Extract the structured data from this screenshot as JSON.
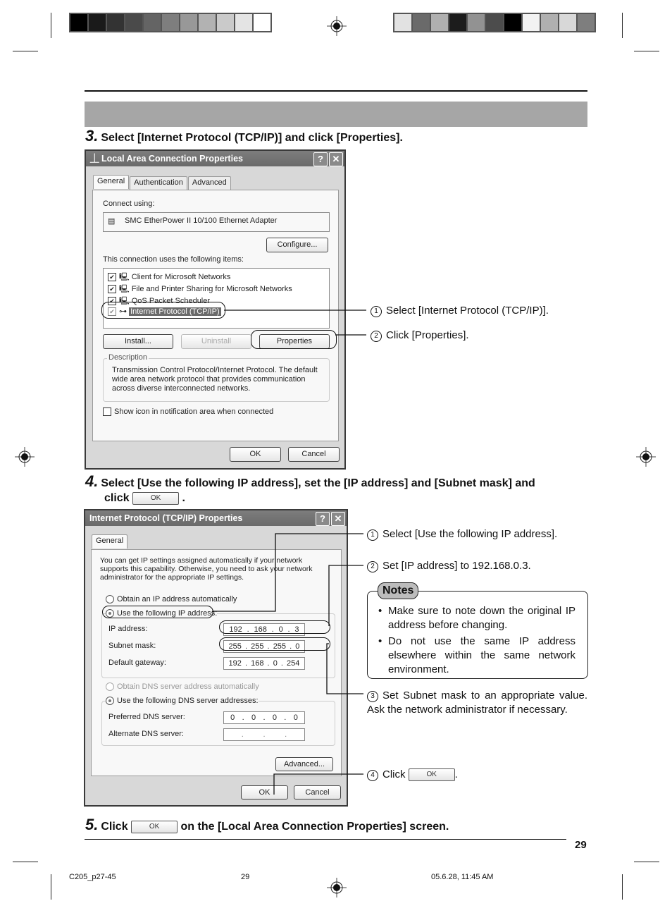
{
  "page": {
    "page_number": "29",
    "footer": {
      "file": "C205_p27-45",
      "page": "29",
      "timestamp": "05.6.28, 11:45 AM"
    }
  },
  "steps": [
    {
      "num": "3.",
      "text": "Select [Internet Protocol (TCP/IP)] and click [Properties]."
    },
    {
      "num": "4.",
      "text_a": "Select [Use the following IP address], set the [IP address] and [Subnet mask] and",
      "text_b": "click",
      "text_c": "."
    },
    {
      "num": "5.",
      "text_a": "Click",
      "text_b": "on the [Local Area Connection Properties] screen."
    }
  ],
  "ok_chip": "OK",
  "dialog1": {
    "title": "Local Area Connection Properties",
    "help": "?",
    "close": "✕",
    "tabs": [
      "General",
      "Authentication",
      "Advanced"
    ],
    "connect_using_label": "Connect using:",
    "adapter": "SMC EtherPower II 10/100 Ethernet Adapter",
    "configure": "Configure...",
    "items_label": "This connection uses the following items:",
    "items": [
      {
        "label": "Client for Microsoft Networks",
        "checked": true
      },
      {
        "label": "File and Printer Sharing for Microsoft Networks",
        "checked": true
      },
      {
        "label": "QoS Packet Scheduler",
        "checked": true
      },
      {
        "label": "Internet Protocol (TCP/IP)",
        "checked": true,
        "selected": true
      }
    ],
    "install": "Install...",
    "uninstall": "Uninstall",
    "properties": "Properties",
    "description_title": "Description",
    "description": "Transmission Control Protocol/Internet Protocol. The default wide area network protocol that provides communication across diverse interconnected networks.",
    "show_icon": "Show icon in notification area when connected",
    "ok": "OK",
    "cancel": "Cancel"
  },
  "callouts1": [
    {
      "n": "1",
      "text": "Select [Internet Protocol (TCP/IP)]."
    },
    {
      "n": "2",
      "text": "Click [Properties]."
    }
  ],
  "dialog2": {
    "title": "Internet Protocol (TCP/IP) Properties",
    "help": "?",
    "close": "✕",
    "tab": "General",
    "intro": "You can get IP settings assigned automatically if your network supports this capability. Otherwise, you need to ask your network administrator for the appropriate IP settings.",
    "obtain_ip": "Obtain an IP address automatically",
    "use_ip": "Use the following IP address:",
    "ip_label": "IP address:",
    "ip_value": [
      "192",
      "168",
      "0",
      "3"
    ],
    "mask_label": "Subnet mask:",
    "mask_value": [
      "255",
      "255",
      "255",
      "0"
    ],
    "gateway_label": "Default gateway:",
    "gateway_value": [
      "192",
      "168",
      "0",
      "254"
    ],
    "obtain_dns": "Obtain DNS server address automatically",
    "use_dns": "Use the following DNS server addresses:",
    "pref_dns_label": "Preferred DNS server:",
    "pref_dns_value": [
      "0",
      "0",
      "0",
      "0"
    ],
    "alt_dns_label": "Alternate DNS server:",
    "alt_dns_value": [
      "",
      "",
      "",
      ""
    ],
    "advanced": "Advanced...",
    "ok": "OK",
    "cancel": "Cancel"
  },
  "callouts2": [
    {
      "n": "1",
      "text": "Select [Use the following IP address]."
    },
    {
      "n": "2",
      "text": "Set [IP address] to 192.168.0.3."
    },
    {
      "n": "3",
      "text": "Set Subnet mask to an appropriate value. Ask the network administrator if necessary."
    },
    {
      "n": "4",
      "text_a": "Click",
      "text_b": "."
    }
  ],
  "notes": {
    "title": "Notes",
    "items": [
      "Make sure to note down the original IP address before changing.",
      "Do not use the same IP address elsewhere within the same network environment."
    ]
  }
}
